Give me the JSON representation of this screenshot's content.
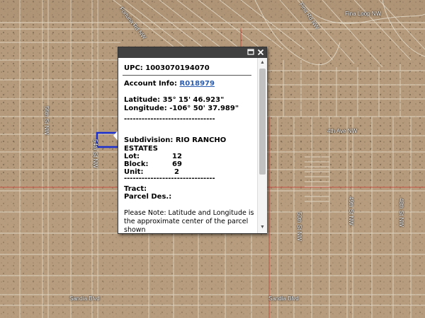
{
  "map": {
    "road_labels": {
      "fortuna_rd": "Fortuna Rd NW",
      "fina_rd": "Fina Rd NW",
      "fina_loop": "Fina Loop NW",
      "ave_4th": "4th Ave NW",
      "st_56th": "56th St NW",
      "st_54th": "54th St NW",
      "st_50th": "50th St NW",
      "st_49th": "49th St NW",
      "st_48th": "48th St NW",
      "sandia_blvd_left": "Sandia Blvd",
      "sandia_blvd_right": "Sandia Blvd"
    },
    "colors": {
      "parcel_lines": "#e2dccd",
      "boundary_red": "#c83c32",
      "selected_parcel": "#1a2fd0"
    }
  },
  "popup": {
    "maximize_icon": "maximize-icon",
    "close_icon": "close-icon",
    "upc": "UPC: 1003070194070",
    "account_label": "Account Info:",
    "account_link": "R018979",
    "latitude": "Latitude: 35° 15' 46.923\"",
    "longitude": "Longitude: -106° 50' 37.989\"",
    "separator1": "-------------------------------",
    "subdivision_line1": "Subdivision: RIO RANCHO",
    "subdivision_line2": "ESTATES",
    "lot_label": "Lot:",
    "lot_value": "12",
    "block_label": "Block:",
    "block_value": "69",
    "unit_label": "Unit:",
    "unit_value": "2",
    "separator2": "-------------------------------",
    "tract": "Tract:",
    "parcel_des": "Parcel Des.:",
    "note_line1": "Please Note: Latitude and Longitude is",
    "note_line2": "the approximate center of the parcel",
    "note_line3": "shown"
  }
}
